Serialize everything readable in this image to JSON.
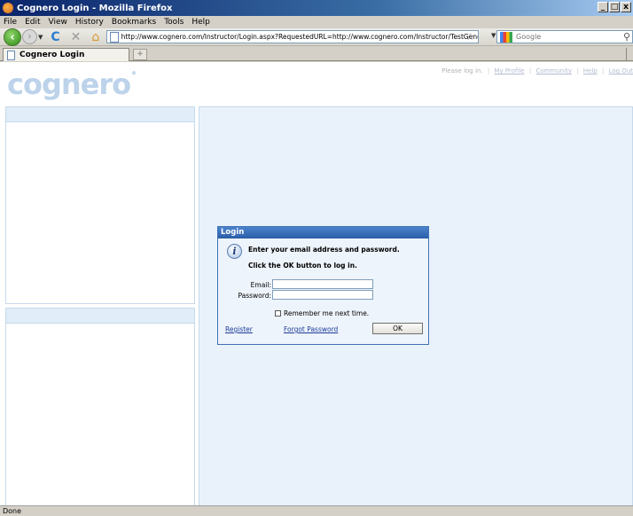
{
  "window": {
    "title": "Cognero Login - Mozilla Firefox",
    "buttons": [
      "_",
      "□",
      "x"
    ]
  },
  "menu": [
    "File",
    "Edit",
    "View",
    "History",
    "Bookmarks",
    "Tools",
    "Help"
  ],
  "nav": {
    "url": "http://www.cognero.com/Instructor/Login.aspx?RequestedURL=http://www.cognero.com/Instructor/TestGenerator.aspx",
    "search_placeholder": "Google",
    "icons": [
      "back-icon",
      "forward-icon",
      "reload-icon",
      "stop-icon",
      "home-icon",
      "star-icon",
      "google-icon",
      "search-icon"
    ]
  },
  "tabs": [
    {
      "label": "Cognero Login"
    }
  ],
  "site": {
    "logo": "cognero",
    "top_links": {
      "prompt": "Please log in.",
      "links": [
        "My Profile",
        "Community",
        "Help",
        "Log Out"
      ]
    }
  },
  "login": {
    "title": "Login",
    "message_1": "Enter your email address and password.",
    "message_2": "Click the OK button to log in.",
    "email_label": "Email:",
    "email_value": "",
    "password_label": "Password:",
    "password_value": "",
    "remember_label": "Remember me next time.",
    "remember_checked": false,
    "register_link": "Register",
    "forgot_link": "Forgot Password",
    "ok_label": "OK"
  },
  "status": {
    "text": "Done"
  }
}
